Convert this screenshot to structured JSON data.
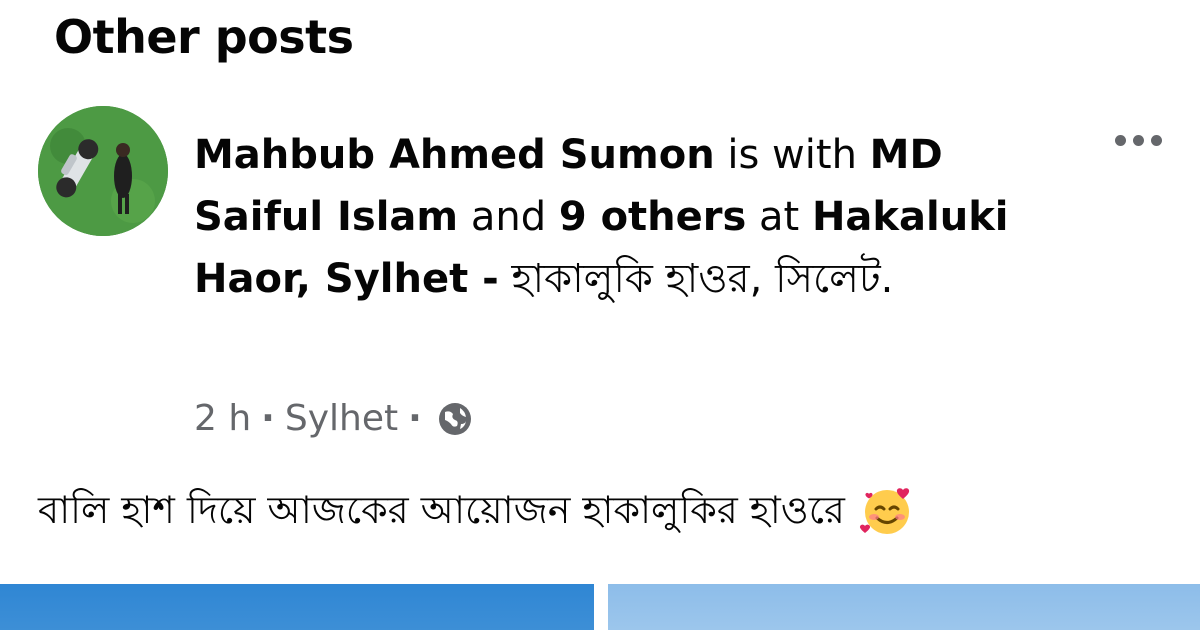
{
  "section": {
    "title": "Other posts"
  },
  "post": {
    "author": "Mahbub Ahmed Sumon",
    "is_with": "is with",
    "tagged_1_part1": "MD",
    "tagged_1_part2": "Saiful Islam",
    "and": "and",
    "others": "9 others",
    "at": "at",
    "location_en": "Hakaluki Haor, Sylhet -",
    "location_bn_1": "হাকালুকি হাওর,",
    "location_bn_2": "সিলেট.",
    "time": "2 h",
    "dot1": "·",
    "place": "Sylhet",
    "dot2": "·",
    "privacy_icon": "globe-icon",
    "text": "বালি হাশ দিয়ে আজকের আয়োজন হাকালুকির হাওরে",
    "emoji": "smiling-face-with-hearts",
    "more_icon": "more-options-icon"
  },
  "colors": {
    "text_primary": "#050505",
    "text_secondary": "#65676b",
    "photo_left": "#2f86d4",
    "photo_right": "#8dbde9"
  }
}
